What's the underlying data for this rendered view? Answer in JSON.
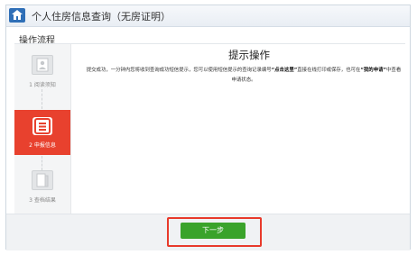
{
  "header": {
    "title": "个人住房信息查询（无房证明）",
    "home_icon": "home-icon"
  },
  "process": {
    "label": "操作流程",
    "steps": [
      {
        "label": "1 阅读须知",
        "icon": "document-person-icon",
        "active": false
      },
      {
        "label": "2 申报信息",
        "icon": "form-icon",
        "active": true
      },
      {
        "label": "3 查档结果",
        "icon": "book-icon",
        "active": false
      }
    ]
  },
  "main": {
    "title": "提示操作",
    "message_part1": "提交成功，一分钟内您将收到查询成功短信提示，您可以使用短信提示的查询记录编号",
    "message_bold1": "“点击这里”",
    "message_part2": "直接在线打印或保存，也可在",
    "message_bold2": "“我的申请”",
    "message_part3": "中查看申请状态。"
  },
  "footer": {
    "next_label": "下一步"
  },
  "colors": {
    "accent_red": "#e8412e",
    "button_green": "#3aa32b",
    "home_blue": "#2f6fb7"
  }
}
